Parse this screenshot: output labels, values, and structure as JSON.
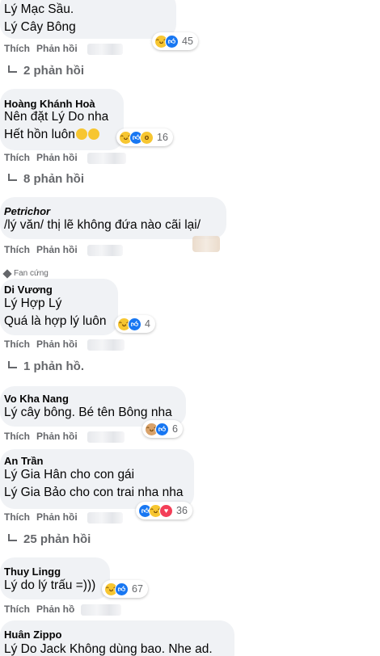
{
  "comments": [
    {
      "lines": [
        "Lý Mạc Sầu.",
        "Lý Cây Bông"
      ],
      "like": "Thích",
      "reply": "Phản hồi",
      "reaction_count": "45",
      "replies_label": "2 phản hồi"
    },
    {
      "author": "Hoàng Khánh Hoà",
      "lines": [
        "Nên đặt Lý Do nha",
        "Hết hồn luôn"
      ],
      "like": "Thích",
      "reply": "Phản hồi",
      "reaction_count": "16",
      "replies_label": "8 phản hồi"
    },
    {
      "author": "Petrichor",
      "lines": [
        "/lý văn/ thị lẽ không đứa nào cãi lại/"
      ],
      "like": "Thích",
      "reply": "Phản hồi"
    },
    {
      "badge": "Fan cứng",
      "author": "Di Vương",
      "lines": [
        "Lý Hợp Lý",
        "Quá là hợp lý luôn"
      ],
      "like": "Thích",
      "reply": "Phản hồi",
      "reaction_count": "4",
      "replies_label": "1 phản hồ."
    },
    {
      "author": "Vo Kha Nang",
      "lines": [
        "Lý cây bông. Bé tên Bông nha"
      ],
      "like": "Thích",
      "reply": "Phản hồi",
      "reaction_count": "6"
    },
    {
      "author": "An Trần",
      "lines": [
        "Lý Gia Hân cho con gái",
        "Lý Gia Bảo cho con trai nha nha"
      ],
      "like": "Thích",
      "reply": "Phản hồi",
      "reaction_count": "36",
      "replies_label": "25 phản hồi"
    },
    {
      "author": "Thuy Lingg",
      "lines": [
        "Lý do lý trấu =)))"
      ],
      "like": "Thích",
      "reply": "Phản hồ",
      "reaction_count": "67"
    },
    {
      "author": "Huân Zippo",
      "lines": [
        "Lý Do Jack Không dùng bao. Nhe ad."
      ]
    }
  ],
  "icons": {
    "haha": "haha-reaction-icon",
    "like": "like-reaction-icon",
    "love": "love-reaction-icon",
    "wow": "wow-reaction-icon",
    "fan": "diamond-icon"
  }
}
